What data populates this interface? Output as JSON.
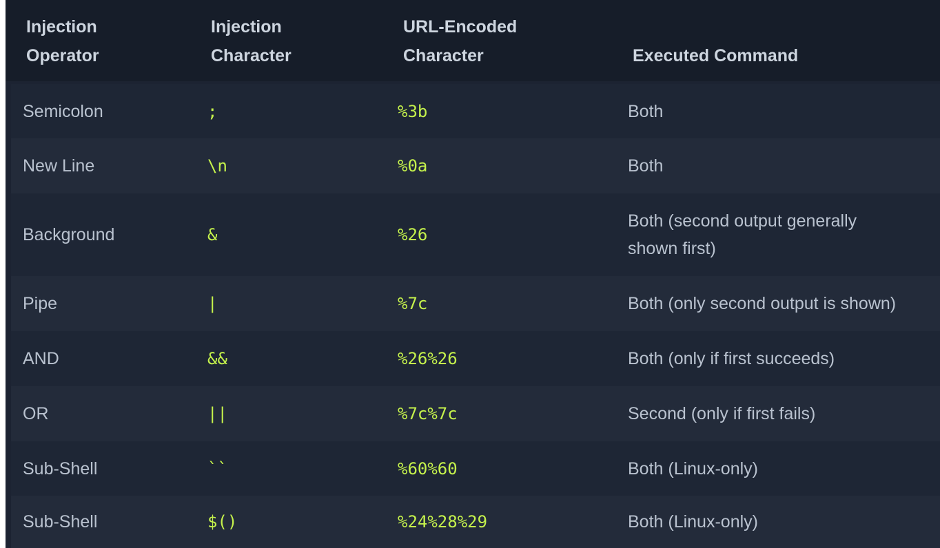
{
  "table": {
    "headers": [
      "Injection\nOperator",
      "Injection\nCharacter",
      "URL-Encoded\nCharacter",
      "Executed Command"
    ],
    "rows": [
      {
        "operator": "Semicolon",
        "character": ";",
        "encoded": "%3b",
        "command": "Both"
      },
      {
        "operator": "New Line",
        "character": "\\n",
        "encoded": "%0a",
        "command": "Both"
      },
      {
        "operator": "Background",
        "character": "&",
        "encoded": "%26",
        "command": "Both (second output generally\nshown first)"
      },
      {
        "operator": "Pipe",
        "character": "|",
        "encoded": "%7c",
        "command": "Both (only second output is shown)"
      },
      {
        "operator": "AND",
        "character": "&&",
        "encoded": "%26%26",
        "command": "Both (only if first succeeds)"
      },
      {
        "operator": "OR",
        "character": "||",
        "encoded": "%7c%7c",
        "command": "Second (only if first fails)"
      },
      {
        "operator": "Sub-Shell",
        "character": "``",
        "encoded": "%60%60",
        "command": "Both (Linux-only)"
      },
      {
        "operator": "Sub-Shell",
        "character": "$()",
        "encoded": "%24%28%29",
        "command": "Both (Linux-only)"
      }
    ]
  },
  "colors": {
    "background": "#1c2332",
    "header_background": "#161d29",
    "header_text": "#cdd5df",
    "body_text": "#b9c2cf",
    "code_text": "#c5f24c"
  }
}
